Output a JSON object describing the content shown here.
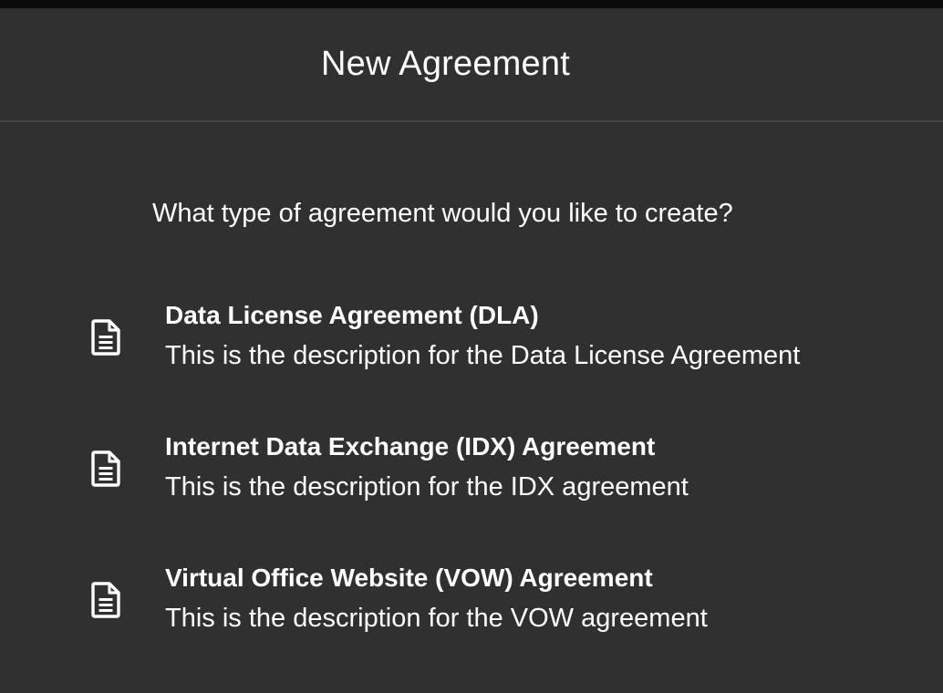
{
  "dialog": {
    "title": "New Agreement",
    "question": "What type of agreement would you like to create?"
  },
  "options": [
    {
      "icon": "document-icon",
      "title": "Data License Agreement (DLA)",
      "description": "This is the description for the Data License Agreement"
    },
    {
      "icon": "document-icon",
      "title": "Internet Data Exchange (IDX) Agreement",
      "description": "This is the description for the IDX agreement"
    },
    {
      "icon": "document-icon",
      "title": "Virtual Office Website (VOW) Agreement",
      "description": "This is the description for the VOW agreement"
    }
  ],
  "colors": {
    "background": "#303030",
    "text": "#ffffff",
    "divider": "#474747",
    "top_strip": "#0a0a0a"
  }
}
